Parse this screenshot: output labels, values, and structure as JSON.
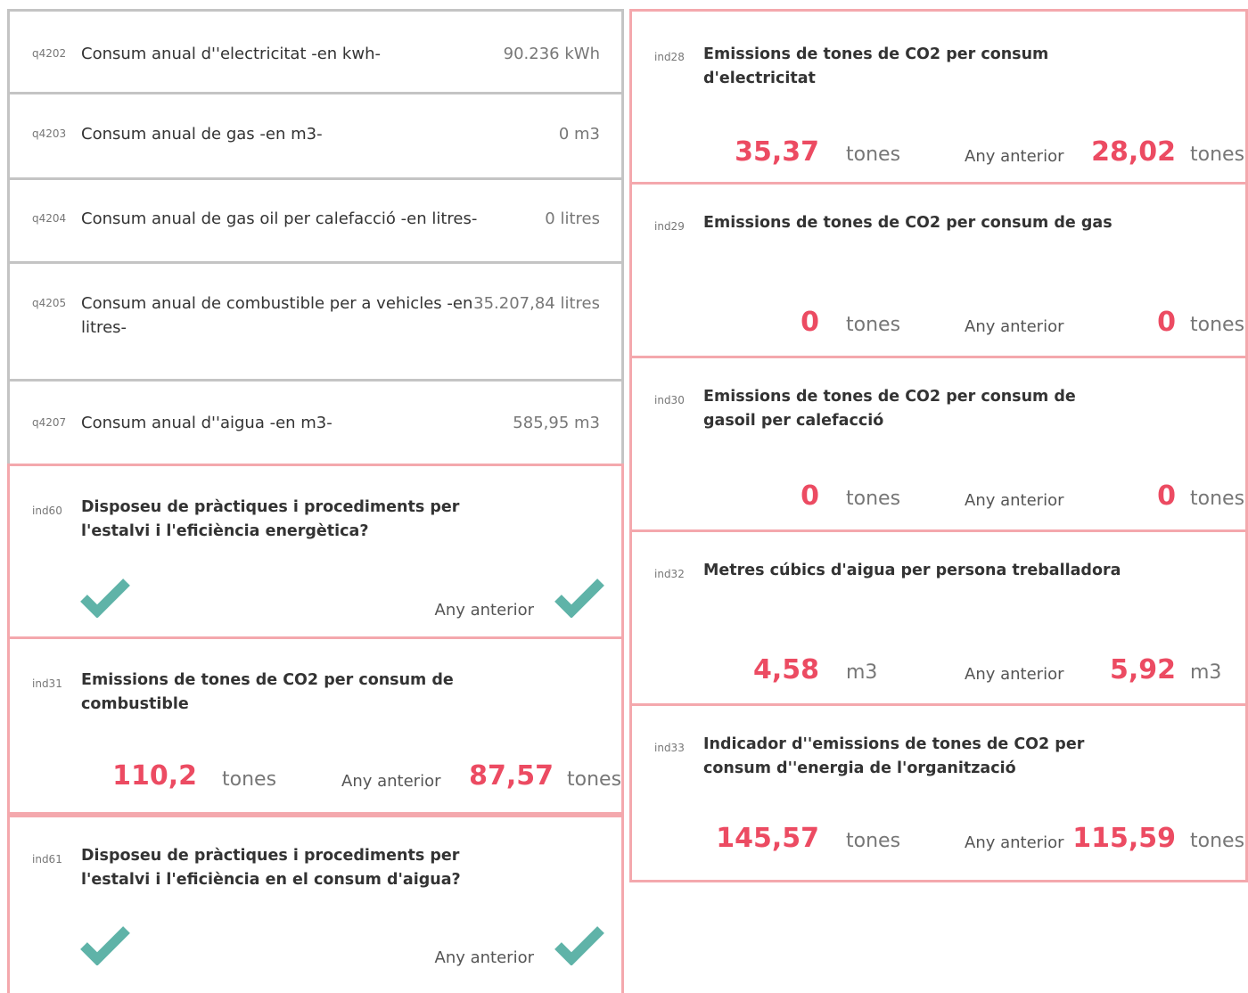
{
  "questions": [
    {
      "code": "q4202",
      "label": "Consum anual d''electricitat -en kwh-",
      "value": "90.236 kWh"
    },
    {
      "code": "q4203",
      "label": "Consum anual de gas -en m3-",
      "value": "0 m3"
    },
    {
      "code": "q4204",
      "label": "Consum anual de gas oil per calefacció -en litres-",
      "value": "0 litres"
    },
    {
      "code": "q4205",
      "label": "Consum anual de combustible per a vehicles -en litres-",
      "value": "35.207,84 litres"
    },
    {
      "code": "q4207",
      "label": "Consum anual d''aigua -en m3-",
      "value": "585,95 m3"
    }
  ],
  "left_indicators": [
    {
      "code": "ind60",
      "title": "Disposeu de pràctiques i procediments per l'estalvi i l'eficiència energètica?",
      "current": "check-icon",
      "prev_label": "Any anterior",
      "prev": "check-icon"
    },
    {
      "code": "ind31",
      "title": "Emissions de tones de CO2 per consum de combustible",
      "value": "110,2",
      "unit": "tones",
      "prev_label": "Any anterior",
      "prev_value": "87,57",
      "prev_unit": "tones"
    },
    {
      "code": "ind61",
      "title": "Disposeu de pràctiques i procediments per l'estalvi i l'eficiència en el consum d'aigua?",
      "current": "check-icon",
      "prev_label": "Any anterior",
      "prev": "check-icon"
    }
  ],
  "right_indicators": [
    {
      "code": "ind28",
      "title": "Emissions de tones de CO2 per consum d'electricitat",
      "value": "35,37",
      "unit": "tones",
      "prev_label": "Any anterior",
      "prev_value": "28,02",
      "prev_unit": "tones"
    },
    {
      "code": "ind29",
      "title": "Emissions de tones de CO2 per consum de gas",
      "value": "0",
      "unit": "tones",
      "prev_label": "Any anterior",
      "prev_value": "0",
      "prev_unit": "tones"
    },
    {
      "code": "ind30",
      "title": "Emissions de tones de CO2 per consum de gasoil per calefacció",
      "value": "0",
      "unit": "tones",
      "prev_label": "Any anterior",
      "prev_value": "0",
      "prev_unit": "tones"
    },
    {
      "code": "ind32",
      "title": "Metres cúbics d'aigua per persona treballadora",
      "value": "4,58",
      "unit": "m3",
      "prev_label": "Any anterior",
      "prev_value": "5,92",
      "prev_unit": "m3"
    },
    {
      "code": "ind33",
      "title": "Indicador d''emissions de tones de CO2 per consum d''energia de l'organització",
      "value": "145,57",
      "unit": "tones",
      "prev_label": "Any anterior",
      "prev_value": "115,59",
      "prev_unit": "tones"
    }
  ],
  "colors": {
    "accent": "#ec4b62",
    "check": "#5fb3a8",
    "pink_border": "#f4a8ad",
    "gray_border": "#c4c4c4"
  }
}
